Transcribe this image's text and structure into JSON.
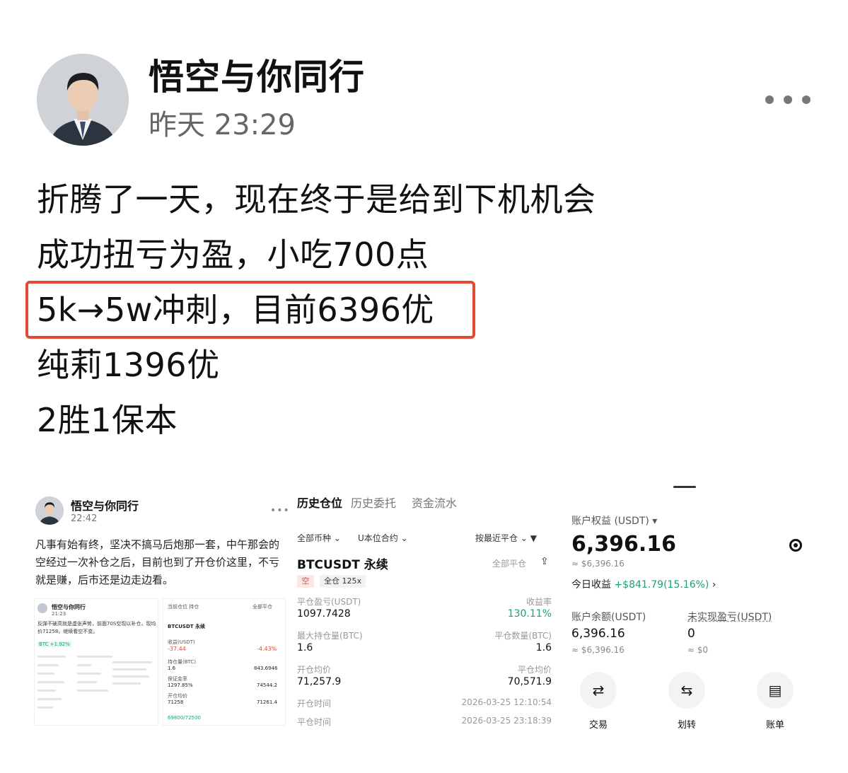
{
  "post": {
    "author": "悟空与你同行",
    "time": "昨天 23:29",
    "lines": [
      "折腾了一天，现在终于是给到下机机会",
      "成功扭亏为盈，小吃700点",
      "5k→5w冲刺，目前6396优",
      "纯莉1396优",
      "2胜1保本"
    ],
    "highlighted_line_index": 2,
    "highlight_color": "#e34a33"
  },
  "image1": {
    "author": "悟空与你同行",
    "time": "22:42",
    "text": "凡事有始有终，坚决不搞马后炮那一套，中午那会的空经过一次补仓之后，目前也到了开仓价这里，不亏就是赚，后市还是边走边看。",
    "inner_post": {
      "author": "悟空与你同行",
      "time": "21:23",
      "text": "反弹不破高就是虚张声势，前面70S空现以补仓，现均价71258，继续看空不变。",
      "tag": "BTC +1.92%"
    },
    "inner_position": {
      "header": "当前仓位 持仓",
      "tag": "全部平仓",
      "symbol": "BTCUSDT 永续",
      "pnl_label": "收益(USDT)",
      "pnl_value": "-37.44",
      "roi_value": "-4.43%",
      "qty_label": "持仓量(BTC)",
      "qty_value": "1.6",
      "margin_value": "843.6946",
      "rate_label": "保证金率",
      "rate_value": "1297.85%",
      "mark_value": "74544.2",
      "open_label": "开仓均价",
      "open_value": "71258",
      "liq_value": "71261.4",
      "tpsl": "69800/72500"
    }
  },
  "image2": {
    "tabs": [
      "历史仓位",
      "历史委托",
      "资金流水"
    ],
    "filters": [
      "全部币种",
      "U本位合约",
      "按最近平仓"
    ],
    "symbol": "BTCUSDT 永续",
    "close_all": "全部平仓",
    "tag_side": "空",
    "tag_mode": "全仓 125x",
    "fields": [
      {
        "label": "平仓盈亏(USDT)",
        "value": "1097.7428",
        "label_r": "收益率",
        "value_r": "130.11%"
      },
      {
        "label": "最大持仓量(BTC)",
        "value": "1.6",
        "label_r": "平仓数量(BTC)",
        "value_r": "1.6"
      },
      {
        "label": "开仓均价",
        "value": "71,257.9",
        "label_r": "平仓均价",
        "value_r": "70,571.9"
      },
      {
        "label": "开仓时间",
        "value": "",
        "label_r": "",
        "value_r": "2026-03-25 12:10:54"
      },
      {
        "label": "平仓时间",
        "value": "",
        "label_r": "",
        "value_r": "2026-03-25 23:18:39"
      }
    ]
  },
  "image3": {
    "equity_label": "账户权益 (USDT)",
    "equity": "6,396.16",
    "equity_approx": "≈ $6,396.16",
    "today_label": "今日收益",
    "today_value": "+$841.79(15.16%)",
    "balance_label": "账户余额(USDT)",
    "balance": "6,396.16",
    "balance_approx": "≈ $6,396.16",
    "unrealized_label": "未实现盈亏(USDT)",
    "unrealized": "0",
    "unrealized_approx": "≈ $0",
    "actions": [
      "交易",
      "划转",
      "账单"
    ],
    "positive_color": "#22a06b"
  }
}
